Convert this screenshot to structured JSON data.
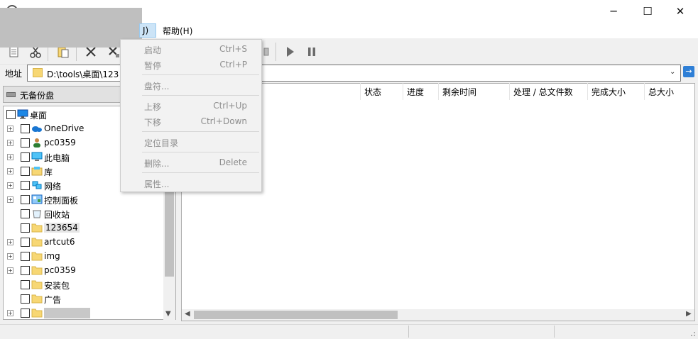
{
  "window": {
    "minimize_glyph": "─",
    "maximize_glyph": "☐",
    "close_glyph": "✕"
  },
  "menubar": {
    "tools_label": "J)",
    "help_label": "帮助(H)"
  },
  "toolbar": {
    "icons": [
      "new-icon",
      "cut-icon",
      "paste-icon",
      "delete-icon",
      "delete-all-icon",
      "play-icon",
      "pause-icon"
    ]
  },
  "address": {
    "label": "地址",
    "value": "D:\\tools\\桌面\\123",
    "go_glyph": "→",
    "dropdown_glyph": "⌄"
  },
  "left": {
    "backup_label": "无备份盘"
  },
  "tree": [
    {
      "label": "桌面",
      "icon": "desktop-icon",
      "level": 0,
      "expander": false
    },
    {
      "label": "OneDrive",
      "icon": "cloud-icon",
      "level": 1,
      "expander": true
    },
    {
      "label": "pc0359",
      "icon": "user-icon",
      "level": 1,
      "expander": true
    },
    {
      "label": "此电脑",
      "icon": "computer-icon",
      "level": 1,
      "expander": true
    },
    {
      "label": "库",
      "icon": "library-icon",
      "level": 1,
      "expander": true
    },
    {
      "label": "网络",
      "icon": "network-icon",
      "level": 1,
      "expander": true
    },
    {
      "label": "控制面板",
      "icon": "control-panel-icon",
      "level": 1,
      "expander": true
    },
    {
      "label": "回收站",
      "icon": "recycle-bin-icon",
      "level": 1,
      "expander": false
    },
    {
      "label": "123654",
      "icon": "folder-icon",
      "level": 1,
      "expander": false,
      "highlight": true
    },
    {
      "label": "artcut6",
      "icon": "folder-icon",
      "level": 1,
      "expander": true
    },
    {
      "label": "img",
      "icon": "folder-icon",
      "level": 1,
      "expander": true
    },
    {
      "label": "pc0359",
      "icon": "folder-icon",
      "level": 1,
      "expander": true
    },
    {
      "label": "安装包",
      "icon": "folder-icon",
      "level": 1,
      "expander": false
    },
    {
      "label": "广告",
      "icon": "folder-icon",
      "level": 1,
      "expander": false
    },
    {
      "label": "",
      "icon": "folder-icon",
      "level": 1,
      "expander": true,
      "redacted": true
    }
  ],
  "list": {
    "columns": [
      "状态",
      "进度",
      "剩余时间",
      "处理 / 总文件数",
      "完成大小",
      "总大小"
    ]
  },
  "context_menu": {
    "items": [
      {
        "label": "启动",
        "shortcut": "Ctrl+S"
      },
      {
        "label": "暂停",
        "shortcut": "Ctrl+P"
      },
      {
        "label": "盘符...",
        "shortcut": ""
      },
      {
        "label": "上移",
        "shortcut": "Ctrl+Up"
      },
      {
        "label": "下移",
        "shortcut": "Ctrl+Down"
      },
      {
        "label": "定位目录",
        "shortcut": ""
      },
      {
        "label": "删除...",
        "shortcut": "Delete"
      },
      {
        "label": "属性...",
        "shortcut": ""
      }
    ]
  },
  "colors": {
    "folder": "#f7d774",
    "accent": "#2f7fd6",
    "menu_highlight": "#cce4f7",
    "disabled_text": "#8d8d8d"
  }
}
